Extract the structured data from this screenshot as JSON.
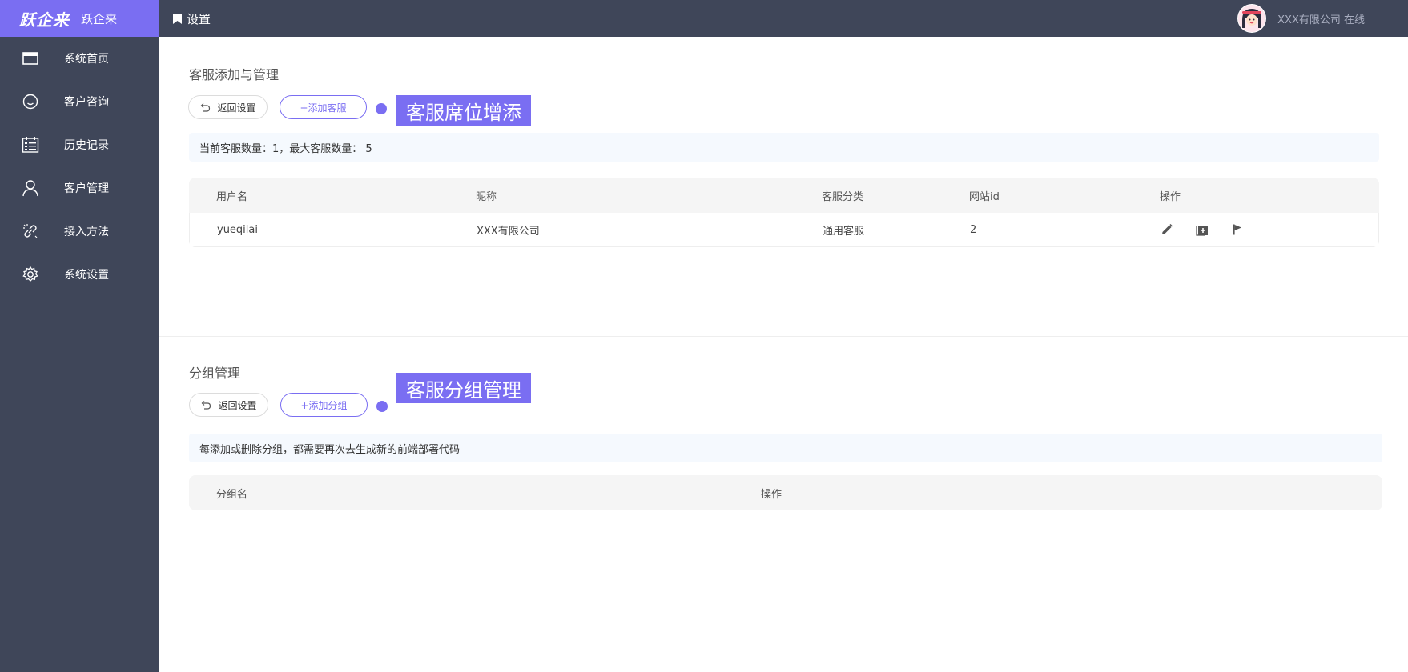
{
  "brand": {
    "logo": "跃企来",
    "name": "跃企来"
  },
  "sidebar": {
    "items": [
      {
        "label": "系统首页",
        "icon": "browser-window-icon"
      },
      {
        "label": "客户咨询",
        "icon": "smiley-icon"
      },
      {
        "label": "历史记录",
        "icon": "calendar-list-icon"
      },
      {
        "label": "客户管理",
        "icon": "user-icon"
      },
      {
        "label": "接入方法",
        "icon": "link-icon"
      },
      {
        "label": "系统设置",
        "icon": "gear-icon"
      }
    ]
  },
  "topbar": {
    "breadcrumb": "设置",
    "user_text": "XXX有限公司 在线"
  },
  "agents_section": {
    "title": "客服添加与管理",
    "back_label": "返回设置",
    "add_label": "+添加客服",
    "callout": "客服席位增添",
    "notice": "当前客服数量：1，最大客服数量： 5",
    "columns": [
      "用户名",
      "昵称",
      "客服分类",
      "网站id",
      "操作"
    ],
    "rows": [
      {
        "username": "yueqilai",
        "nickname": "XXX有限公司",
        "category": "通用客服",
        "site_id": "2",
        "actions": [
          "edit-icon",
          "add-box-icon",
          "flag-icon"
        ]
      }
    ]
  },
  "groups_section": {
    "title": "分组管理",
    "back_label": "返回设置",
    "add_label": "+添加分组",
    "callout": "客服分组管理",
    "notice": "每添加或删除分组，都需要再次去生成新的前端部署代码",
    "columns": [
      "分组名",
      "操作"
    ],
    "rows": []
  },
  "colors": {
    "accent": "#7a6ef2",
    "sidebar": "#3f4659",
    "notice_bg": "#f5f9fe",
    "table_head": "#f5f5f5"
  }
}
